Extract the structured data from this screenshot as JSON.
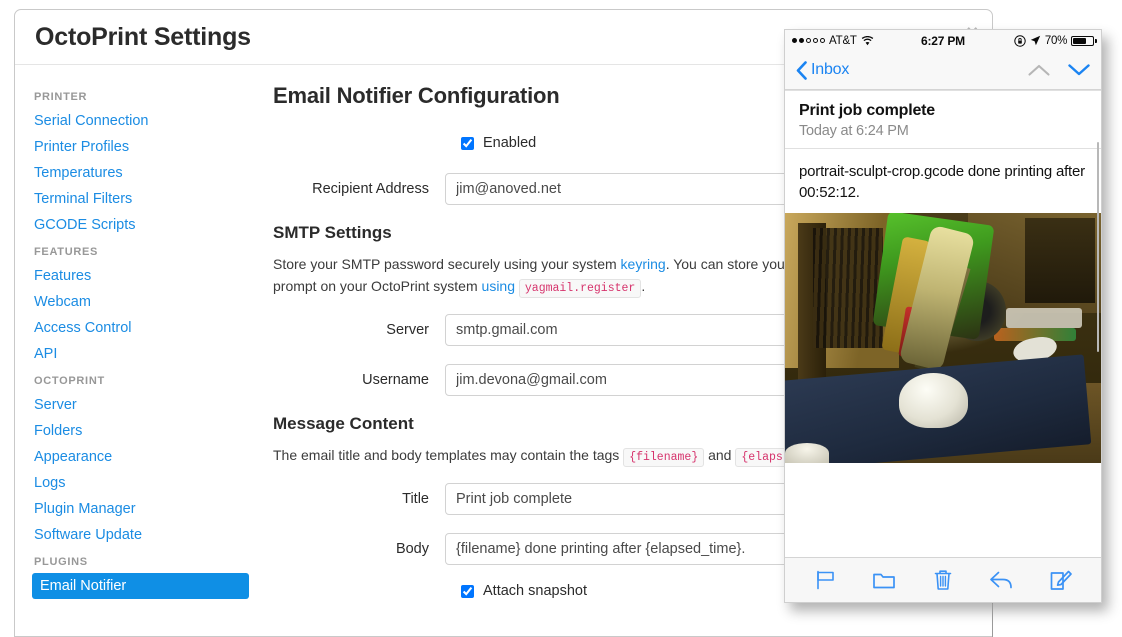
{
  "modal": {
    "title": "OctoPrint Settings",
    "close_label": "×"
  },
  "sidebar": {
    "groups": [
      {
        "label": "PRINTER",
        "items": [
          {
            "label": "Serial Connection"
          },
          {
            "label": "Printer Profiles"
          },
          {
            "label": "Temperatures"
          },
          {
            "label": "Terminal Filters"
          },
          {
            "label": "GCODE Scripts"
          }
        ]
      },
      {
        "label": "FEATURES",
        "items": [
          {
            "label": "Features"
          },
          {
            "label": "Webcam"
          },
          {
            "label": "Access Control"
          },
          {
            "label": "API"
          }
        ]
      },
      {
        "label": "OCTOPRINT",
        "items": [
          {
            "label": "Server"
          },
          {
            "label": "Folders"
          },
          {
            "label": "Appearance"
          },
          {
            "label": "Logs"
          },
          {
            "label": "Plugin Manager"
          },
          {
            "label": "Software Update"
          }
        ]
      },
      {
        "label": "PLUGINS",
        "items": [
          {
            "label": "Email Notifier"
          }
        ]
      }
    ],
    "active_item": "Email Notifier"
  },
  "main": {
    "page_title": "Email Notifier Configuration",
    "enabled_label": "Enabled",
    "enabled_checked": true,
    "recipient_label": "Recipient Address",
    "recipient_value": "jim@anoved.net",
    "smtp": {
      "heading": "SMTP Settings",
      "help_part1": "Store your SMTP password securely using your system ",
      "help_link1": "keyring",
      "help_part2": ". You can store you",
      "help_part3": "prompt on your OctoPrint system ",
      "help_link2": "using",
      "help_code": "yagmail.register",
      "help_part4": ".",
      "server_label": "Server",
      "server_value": "smtp.gmail.com",
      "username_label": "Username",
      "username_value": "jim.devona@gmail.com"
    },
    "message": {
      "heading": "Message Content",
      "help_part1": "The email title and body templates may contain the tags ",
      "tag1": "{filename}",
      "help_part2": " and ",
      "tag2": "{elaps",
      "title_label": "Title",
      "title_value": "Print job complete",
      "body_label": "Body",
      "body_value": "{filename} done printing after {elapsed_time}.",
      "attach_label": "Attach snapshot",
      "attach_checked": true
    }
  },
  "phone": {
    "status": {
      "signal_dots_filled": 2,
      "signal_dots_total": 5,
      "carrier": "AT&T",
      "wifi_icon": "wifi-icon",
      "time": "6:27 PM",
      "rotation_lock_icon": "rotation-lock-icon",
      "location_icon": "location-arrow-icon",
      "battery_percent": "70%",
      "battery_level": 70
    },
    "nav": {
      "back_label": "Inbox",
      "back_icon": "chevron-left-icon",
      "prev_message_icon": "chevron-up-icon",
      "next_message_icon": "chevron-down-icon"
    },
    "mail": {
      "subject": "Print job complete",
      "date": "Today at 6:24 PM",
      "body": "portrait-sculpt-crop.gcode done printing after 00:52:12.",
      "attachment_alt": "3D printer photo with printed face sculpture on blue print bed"
    },
    "toolbar": [
      {
        "name": "flag-icon",
        "label": "Flag"
      },
      {
        "name": "folder-icon",
        "label": "Move to folder"
      },
      {
        "name": "trash-icon",
        "label": "Delete"
      },
      {
        "name": "reply-icon",
        "label": "Reply"
      },
      {
        "name": "compose-icon",
        "label": "Compose"
      }
    ]
  },
  "colors": {
    "link_blue": "#1b8ce3",
    "active_blue": "#0f8fe5",
    "ios_blue": "#1b84f2",
    "code_pink": "#d6336c",
    "disabled_gray": "#b6b6b6"
  }
}
